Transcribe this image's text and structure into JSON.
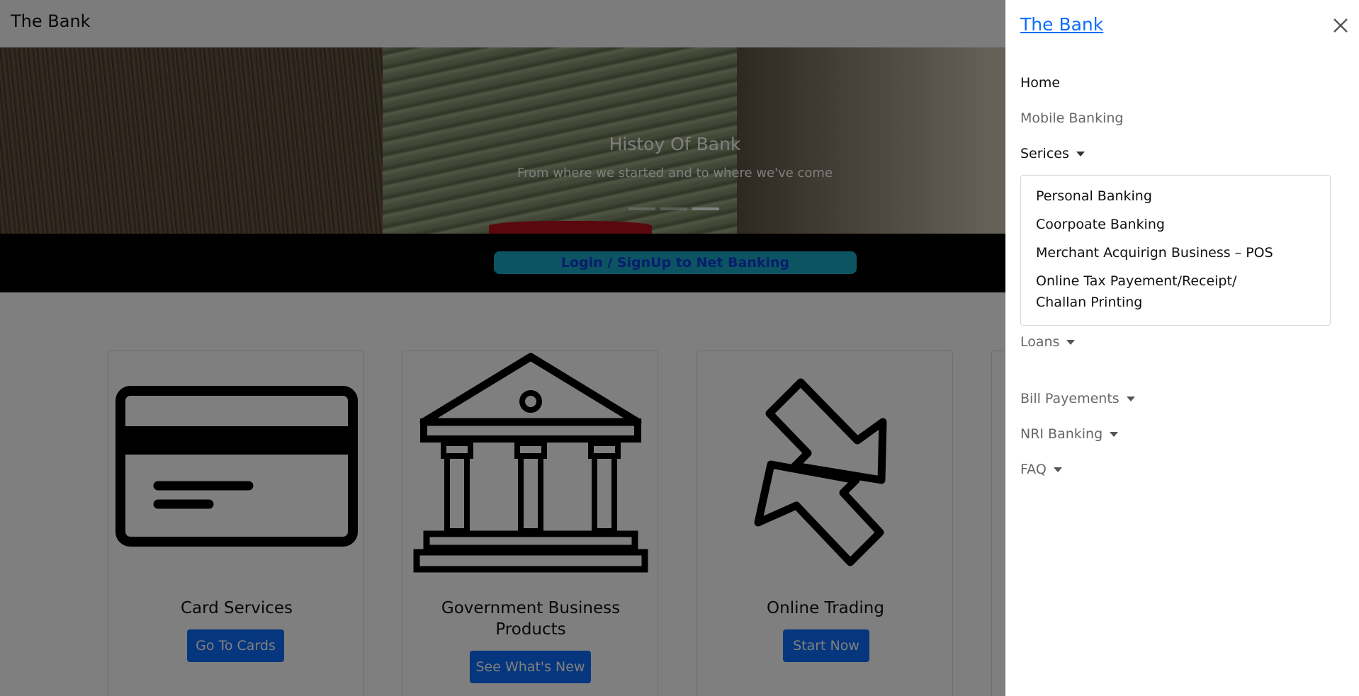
{
  "navbar": {
    "brand": "The Bank"
  },
  "carousel": {
    "title": "Histoy Of Bank",
    "subtitle": "From where we started and to where we've come",
    "slides": 3,
    "active_slide": 3
  },
  "login_band": {
    "button_label": "Login / SignUp to Net Banking"
  },
  "cards": [
    {
      "title": "Card Services",
      "button": "Go To Cards",
      "icon": "credit-card-icon"
    },
    {
      "title": "Government Business Products",
      "button": "See What's New",
      "icon": "bank-building-icon"
    },
    {
      "title": "Online Trading",
      "button": "Start Now",
      "icon": "exchange-arrows-icon"
    }
  ],
  "offcanvas": {
    "title": "The Bank",
    "close_icon": "close-icon",
    "nav": {
      "home": "Home",
      "mobile_banking": "Mobile Banking",
      "services": "Serices",
      "loans": "Loans",
      "bill_payments": "Bill Payements",
      "nri_banking": "NRI Banking",
      "faq": "FAQ"
    },
    "services_dropdown": {
      "personal": "Personal Banking",
      "corporate": "Coorpoate Banking",
      "merchant": "Merchant Acquirign Business – POS",
      "tax_line1": "Online Tax Payement/Receipt/",
      "tax_line2": "Challan Printing"
    }
  },
  "colors": {
    "accent": "#0d6efd",
    "login_button": "#1aa8c7",
    "backdrop": "rgba(0,0,0,0.5)"
  }
}
